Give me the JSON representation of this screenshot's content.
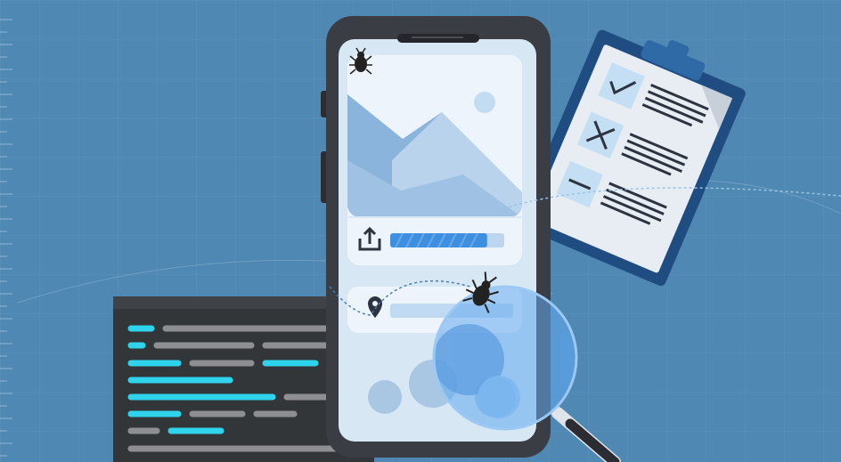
{
  "illustration": {
    "subject": "mobile-app-bug-testing",
    "colors": {
      "background": "#4f88b3",
      "grid_line": "#6a9ac0",
      "phone_body": "#3a3d44",
      "screen_bg": "#d8e7f4",
      "card_bg": "#eef4fb",
      "mountain_dark": "#8ab4dc",
      "mountain_light": "#b9d3ec",
      "progress_fill": "#3f8fe0",
      "code_panel": "#333639",
      "code_cyan": "#2fd3ec",
      "code_gray": "#8e8f92",
      "clipboard_board": "#1f4d82",
      "clipboard_paper": "#e7edf3",
      "check_box_fill": "#c4dff3",
      "magnifier_lens": "#63a9ee",
      "bug": "#222222"
    },
    "icons": [
      "bug-icon",
      "upload-icon",
      "location-pin-icon",
      "check-mark-icon",
      "x-mark-icon",
      "magnifying-glass-icon",
      "image-placeholder"
    ],
    "upload_progress": 0.85
  }
}
